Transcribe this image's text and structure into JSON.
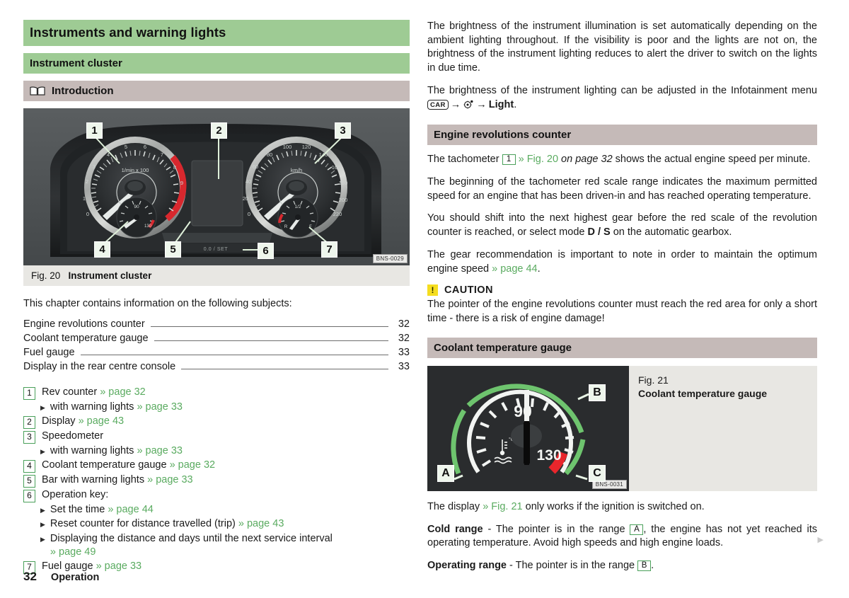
{
  "chapter": {
    "title": "Instruments and warning lights"
  },
  "section": {
    "title": "Instrument cluster"
  },
  "subsection": {
    "title": "Introduction",
    "icon": "book-icon"
  },
  "figure20": {
    "number": "Fig. 20",
    "caption": "Instrument cluster",
    "code": "BNS-0029",
    "callouts": [
      "1",
      "2",
      "3",
      "4",
      "5",
      "6",
      "7"
    ],
    "gauge_labels": {
      "tacho_unit": "1/min x 100",
      "speedo_unit": "km/h",
      "coolant_low": "90",
      "coolant_high": "130",
      "fuel_half": "1/2",
      "fuel_reserve": "R",
      "fuel_full": "F",
      "trip_display": "0.0 / SET"
    }
  },
  "toc": {
    "intro": "This chapter contains information on the following subjects:",
    "rows": [
      {
        "label": "Engine revolutions counter",
        "page": "32"
      },
      {
        "label": "Coolant temperature gauge",
        "page": "32"
      },
      {
        "label": "Fuel gauge",
        "page": "33"
      },
      {
        "label": "Display in the rear centre console",
        "page": "33"
      }
    ]
  },
  "key_list": [
    {
      "num": "1",
      "text": "Rev counter",
      "ref": "» page 32",
      "subs": [
        {
          "text": "with warning lights",
          "ref": "» page 33"
        }
      ]
    },
    {
      "num": "2",
      "text": "Display",
      "ref": "» page 43",
      "subs": []
    },
    {
      "num": "3",
      "text": "Speedometer",
      "ref": "",
      "subs": [
        {
          "text": "with warning lights",
          "ref": "» page 33"
        }
      ]
    },
    {
      "num": "4",
      "text": "Coolant temperature gauge",
      "ref": "» page 32",
      "subs": []
    },
    {
      "num": "5",
      "text": "Bar with warning lights",
      "ref": "» page 33",
      "subs": []
    },
    {
      "num": "6",
      "text": "Operation key:",
      "ref": "",
      "subs": [
        {
          "text": "Set the time",
          "ref": "» page 44"
        },
        {
          "text": "Reset counter for distance travelled (trip)",
          "ref": "» page 43"
        },
        {
          "text": "Displaying the distance and days until the next service interval",
          "ref": "» page 49"
        }
      ]
    },
    {
      "num": "7",
      "text": "Fuel gauge",
      "ref": "» page 33",
      "subs": []
    }
  ],
  "right": {
    "para_brightness_auto": "The brightness of the instrument illumination is set automatically depending on the ambient lighting throughout. If the visibility is poor and the lights are not on, the brightness of the instrument lighting reduces to alert the driver to switch on the lights in due time.",
    "para_infotainment_pre": "The brightness of the instrument lighting can be adjusted in the Infotainment menu ",
    "menu_car_label": "CAR",
    "menu_arrow": "→",
    "menu_gear_icon": "gear-icon",
    "menu_light_label": "Light",
    "menu_trailing": ".",
    "engine_heading": "Engine revolutions counter",
    "tacho_pre": "The tachometer ",
    "tacho_badge": "1",
    "tacho_ref": "» Fig. 20",
    "tacho_italic": " on page 32",
    "tacho_post": " shows the actual engine speed per minute.",
    "para_red_scale": "The beginning of the tachometer red scale range indicates the maximum permitted speed for an engine that has been driven-in and has reached operating temperature.",
    "para_shift_pre": "You should shift into the next highest gear before the red scale of the revolution counter is reached, or select mode ",
    "para_shift_bold": "D / S",
    "para_shift_post": " on the automatic gearbox.",
    "para_gear_pre": "The gear recommendation is important to note in order to maintain the optimum engine speed ",
    "para_gear_ref": "» page 44",
    "para_gear_post": ".",
    "caution_label": "CAUTION",
    "caution_icon": "warning-icon",
    "caution_text": "The pointer of the engine revolutions counter must reach the red area for only a short time - there is a risk of engine damage!",
    "coolant_heading": "Coolant temperature gauge",
    "display_pre": "The display ",
    "display_ref": "» Fig. 21",
    "display_post": " only works if the ignition is switched on.",
    "cold_bold": "Cold range",
    "cold_mid": " - The pointer is in the range ",
    "cold_badge": "A",
    "cold_post": ", the engine has not yet reached its operating temperature. Avoid high speeds and high engine loads.",
    "operating_bold": "Operating range",
    "operating_mid": " - The pointer is in the range ",
    "operating_badge": "B",
    "operating_post": "."
  },
  "figure21": {
    "number": "Fig. 21",
    "caption": "Coolant temperature gauge",
    "code": "BNS-0031",
    "callouts": [
      "A",
      "B",
      "C"
    ],
    "dial_low": "90",
    "dial_high": "130",
    "dial_icon": "coolant-temp-icon"
  },
  "footer": {
    "page_number": "32",
    "section": "Operation"
  },
  "continuation_marker": "▶",
  "colors": {
    "heading_green": "#9ecb94",
    "heading_taupe": "#c5bab8",
    "link_green": "#5aab60",
    "caution_yellow": "#f5dd20",
    "figure_bg": "#e8e7e3",
    "redzone": "#e8262c"
  }
}
